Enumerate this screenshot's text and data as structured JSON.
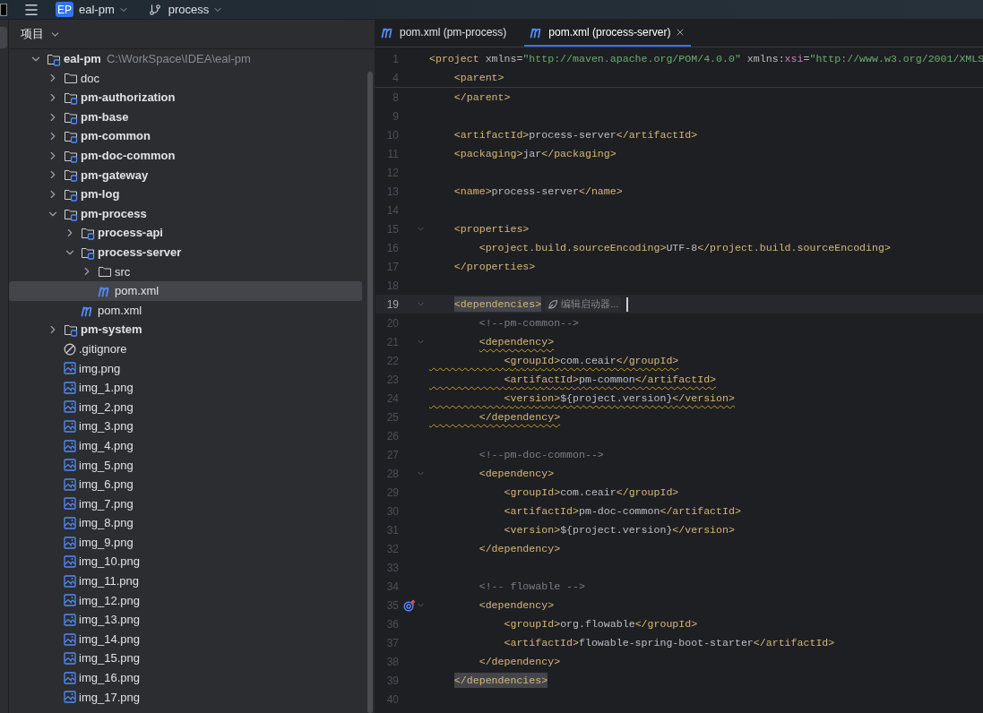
{
  "toolbar": {
    "project_badge": "EP",
    "project": "eal-pm",
    "branch": "process"
  },
  "project_panel": {
    "title": "项目",
    "tree": [
      {
        "name": "eal-pm",
        "kind": "module",
        "path": "C:\\WorkSpace\\IDEA\\eal-pm",
        "expanded": true,
        "selected": false,
        "children": [
          {
            "name": "doc",
            "kind": "folder",
            "expanded": false,
            "selected": false
          },
          {
            "name": "pm-authorization",
            "kind": "module",
            "expanded": false,
            "selected": false
          },
          {
            "name": "pm-base",
            "kind": "module",
            "expanded": false,
            "selected": false
          },
          {
            "name": "pm-common",
            "kind": "module",
            "expanded": false,
            "selected": false
          },
          {
            "name": "pm-doc-common",
            "kind": "module",
            "expanded": false,
            "selected": false
          },
          {
            "name": "pm-gateway",
            "kind": "module",
            "expanded": false,
            "selected": false
          },
          {
            "name": "pm-log",
            "kind": "module",
            "expanded": false,
            "selected": false
          },
          {
            "name": "pm-process",
            "kind": "module",
            "expanded": true,
            "selected": false,
            "children": [
              {
                "name": "process-api",
                "kind": "module",
                "expanded": false,
                "selected": false
              },
              {
                "name": "process-server",
                "kind": "module",
                "expanded": true,
                "selected": false,
                "children": [
                  {
                    "name": "src",
                    "kind": "folder",
                    "expanded": false,
                    "selected": false
                  },
                  {
                    "name": "pom.xml",
                    "kind": "maven",
                    "selected": true
                  }
                ]
              },
              {
                "name": "pom.xml",
                "kind": "maven",
                "selected": false
              }
            ]
          },
          {
            "name": "pm-system",
            "kind": "module",
            "expanded": false,
            "selected": false
          },
          {
            "name": ".gitignore",
            "kind": "ignore",
            "selected": false
          },
          {
            "name": "img.png",
            "kind": "image",
            "selected": false
          },
          {
            "name": "img_1.png",
            "kind": "image",
            "selected": false
          },
          {
            "name": "img_2.png",
            "kind": "image",
            "selected": false
          },
          {
            "name": "img_3.png",
            "kind": "image",
            "selected": false
          },
          {
            "name": "img_4.png",
            "kind": "image",
            "selected": false
          },
          {
            "name": "img_5.png",
            "kind": "image",
            "selected": false
          },
          {
            "name": "img_6.png",
            "kind": "image",
            "selected": false
          },
          {
            "name": "img_7.png",
            "kind": "image",
            "selected": false
          },
          {
            "name": "img_8.png",
            "kind": "image",
            "selected": false
          },
          {
            "name": "img_9.png",
            "kind": "image",
            "selected": false
          },
          {
            "name": "img_10.png",
            "kind": "image",
            "selected": false
          },
          {
            "name": "img_11.png",
            "kind": "image",
            "selected": false
          },
          {
            "name": "img_12.png",
            "kind": "image",
            "selected": false
          },
          {
            "name": "img_13.png",
            "kind": "image",
            "selected": false
          },
          {
            "name": "img_14.png",
            "kind": "image",
            "selected": false
          },
          {
            "name": "img_15.png",
            "kind": "image",
            "selected": false
          },
          {
            "name": "img_16.png",
            "kind": "image",
            "selected": false
          },
          {
            "name": "img_17.png",
            "kind": "image",
            "selected": false
          }
        ]
      }
    ]
  },
  "editor": {
    "tabs": [
      {
        "label": "pom.xml (pm-process)",
        "selected": false
      },
      {
        "label": "pom.xml (process-server)",
        "selected": true
      }
    ],
    "sticky_lines": [
      {
        "n": "1",
        "segs": [
          {
            "kind": "tag",
            "t": "<project"
          },
          {
            "kind": "attr",
            "t": " xmlns="
          },
          {
            "kind": "val",
            "t": "\"http://maven.apache.org/POM/4.0.0\""
          },
          {
            "kind": "attr",
            "t": " xmlns:"
          },
          {
            "kind": "ns",
            "t": "xsi"
          },
          {
            "kind": "attr",
            "t": "="
          },
          {
            "kind": "val",
            "t": "\"http://www.w3.org/2001/XMLS"
          }
        ]
      },
      {
        "n": "4",
        "segs": [
          {
            "kind": "tag",
            "t": "    <parent>"
          }
        ]
      }
    ],
    "lines": [
      {
        "n": "8",
        "segs": [
          {
            "kind": "tag",
            "t": "    </parent>"
          }
        ]
      },
      {
        "n": "9"
      },
      {
        "n": "10",
        "segs": [
          {
            "kind": "tag",
            "t": "    <artifactId>"
          },
          {
            "kind": "text",
            "t": "process-server"
          },
          {
            "kind": "tag",
            "t": "</artifactId>"
          }
        ]
      },
      {
        "n": "11",
        "segs": [
          {
            "kind": "tag",
            "t": "    <packaging>"
          },
          {
            "kind": "text",
            "t": "jar"
          },
          {
            "kind": "tag",
            "t": "</packaging>"
          }
        ]
      },
      {
        "n": "12"
      },
      {
        "n": "13",
        "segs": [
          {
            "kind": "tag",
            "t": "    <name>"
          },
          {
            "kind": "text",
            "t": "process-server"
          },
          {
            "kind": "tag",
            "t": "</name>"
          }
        ]
      },
      {
        "n": "14"
      },
      {
        "n": "15",
        "fold": true,
        "segs": [
          {
            "kind": "tag",
            "t": "    <properties>"
          }
        ]
      },
      {
        "n": "16",
        "segs": [
          {
            "kind": "tag",
            "t": "        <project.build.sourceEncoding>"
          },
          {
            "kind": "text",
            "t": "UTF-8"
          },
          {
            "kind": "tag",
            "t": "</project.build.sourceEncoding>"
          }
        ]
      },
      {
        "n": "17",
        "segs": [
          {
            "kind": "tag",
            "t": "    </properties>"
          }
        ]
      },
      {
        "n": "18"
      },
      {
        "n": "19",
        "fold": true,
        "current": true,
        "hint": "编辑启动器...",
        "segs": [
          {
            "kind": "tag",
            "t": "    <dependencies>",
            "match": true
          }
        ]
      },
      {
        "n": "20",
        "segs": [
          {
            "kind": "comment",
            "t": "        <!--pm-common-->"
          }
        ]
      },
      {
        "n": "21",
        "fold": true,
        "warn": true,
        "segs": [
          {
            "kind": "tag",
            "t": "        <dependency>"
          }
        ]
      },
      {
        "n": "22",
        "warn": true,
        "warn_margin": true,
        "segs": [
          {
            "kind": "tag",
            "t": "            <groupId>"
          },
          {
            "kind": "text",
            "t": "com.ceair"
          },
          {
            "kind": "tag",
            "t": "</groupId>"
          }
        ]
      },
      {
        "n": "23",
        "warn": true,
        "warn_margin": true,
        "segs": [
          {
            "kind": "tag",
            "t": "            <artifactId>"
          },
          {
            "kind": "text",
            "t": "pm-common"
          },
          {
            "kind": "tag",
            "t": "</artifactId>"
          }
        ]
      },
      {
        "n": "24",
        "warn": true,
        "warn_margin": true,
        "segs": [
          {
            "kind": "tag",
            "t": "            <version>"
          },
          {
            "kind": "text",
            "t": "${project.version}"
          },
          {
            "kind": "tag",
            "t": "</version>"
          }
        ]
      },
      {
        "n": "25",
        "warn": true,
        "warn_margin": true,
        "segs": [
          {
            "kind": "tag",
            "t": "        </dependency>"
          }
        ]
      },
      {
        "n": "26"
      },
      {
        "n": "27",
        "segs": [
          {
            "kind": "comment",
            "t": "        <!--pm-doc-common-->"
          }
        ]
      },
      {
        "n": "28",
        "fold": true,
        "segs": [
          {
            "kind": "tag",
            "t": "        <dependency>"
          }
        ]
      },
      {
        "n": "29",
        "segs": [
          {
            "kind": "tag",
            "t": "            <groupId>"
          },
          {
            "kind": "text",
            "t": "com.ceair"
          },
          {
            "kind": "tag",
            "t": "</groupId>"
          }
        ]
      },
      {
        "n": "30",
        "segs": [
          {
            "kind": "tag",
            "t": "            <artifactId>"
          },
          {
            "kind": "text",
            "t": "pm-doc-common"
          },
          {
            "kind": "tag",
            "t": "</artifactId>"
          }
        ]
      },
      {
        "n": "31",
        "segs": [
          {
            "kind": "tag",
            "t": "            <version>"
          },
          {
            "kind": "text",
            "t": "${project.version}"
          },
          {
            "kind": "tag",
            "t": "</version>"
          }
        ]
      },
      {
        "n": "32",
        "segs": [
          {
            "kind": "tag",
            "t": "        </dependency>"
          }
        ]
      },
      {
        "n": "33"
      },
      {
        "n": "34",
        "segs": [
          {
            "kind": "comment",
            "t": "        <!-- flowable -->"
          }
        ]
      },
      {
        "n": "35",
        "fold": true,
        "gutter": {
          "kind": "implemented"
        },
        "segs": [
          {
            "kind": "tag",
            "t": "        <dependency>"
          }
        ]
      },
      {
        "n": "36",
        "segs": [
          {
            "kind": "tag",
            "t": "            <groupId>"
          },
          {
            "kind": "text",
            "t": "org.flowable"
          },
          {
            "kind": "tag",
            "t": "</groupId>"
          }
        ]
      },
      {
        "n": "37",
        "segs": [
          {
            "kind": "tag",
            "t": "            <artifactId>"
          },
          {
            "kind": "text",
            "t": "flowable-spring-boot-starter"
          },
          {
            "kind": "tag",
            "t": "</artifactId>"
          }
        ]
      },
      {
        "n": "38",
        "segs": [
          {
            "kind": "tag",
            "t": "        </dependency>"
          }
        ]
      },
      {
        "n": "39",
        "segs": [
          {
            "kind": "tag",
            "t": "    </dependencies>",
            "match": true
          }
        ]
      },
      {
        "n": "40"
      }
    ]
  }
}
